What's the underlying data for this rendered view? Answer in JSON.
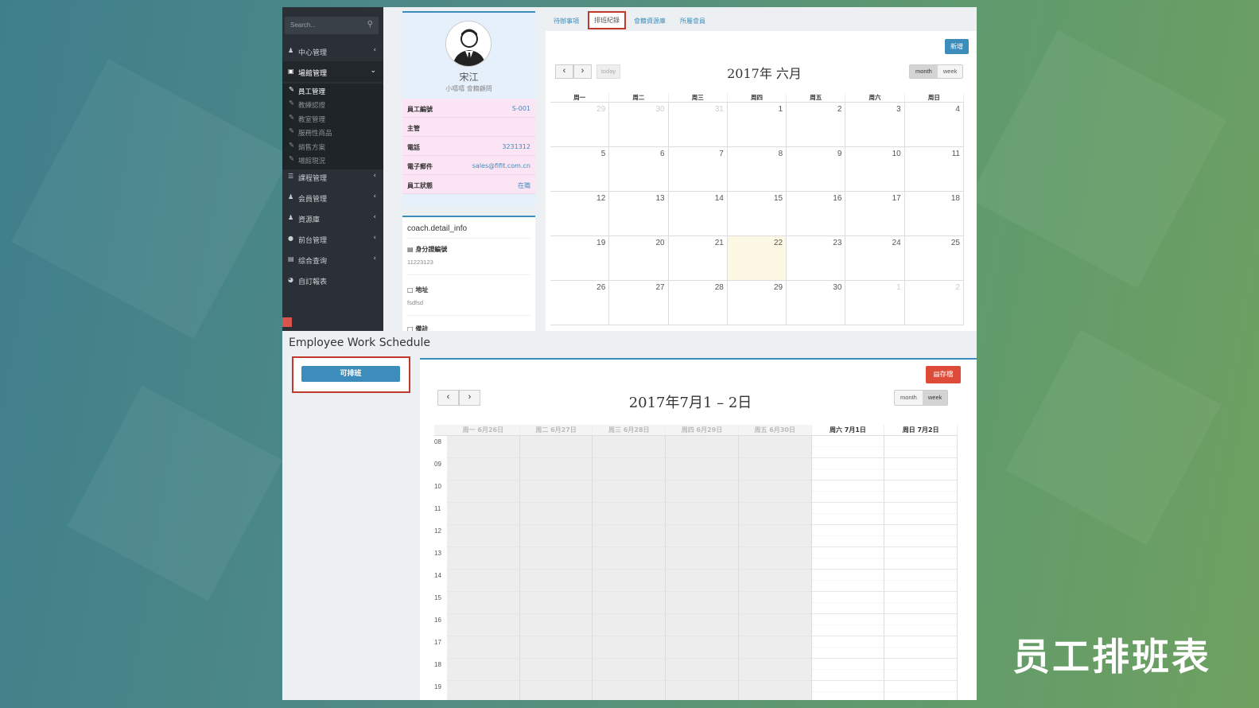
{
  "overlay_title": "员工排班表",
  "sidebar": {
    "search_placeholder": "Search...",
    "items": [
      {
        "label": "中心管理",
        "icon": "user-tie-icon"
      },
      {
        "label": "場館管理",
        "icon": "building-icon"
      },
      {
        "label": "課程管理",
        "icon": "book-icon"
      },
      {
        "label": "会員管理",
        "icon": "users-icon"
      },
      {
        "label": "資源庫",
        "icon": "user-icon"
      },
      {
        "label": "前台管理",
        "icon": "comments-icon"
      },
      {
        "label": "综合查询",
        "icon": "chart-icon"
      },
      {
        "label": "自訂報表",
        "icon": "pie-icon"
      }
    ],
    "sub_items": [
      "員工管理",
      "教練認證",
      "教室管理",
      "服務性商品",
      "銷售方案",
      "場館現況"
    ]
  },
  "profile": {
    "name": "宋江",
    "role": "小嘻嘻 會籍顧問",
    "rows": [
      {
        "key": "員工編號",
        "value": "S-001"
      },
      {
        "key": "主管",
        "value": ""
      },
      {
        "key": "電話",
        "value": "3231312"
      },
      {
        "key": "電子郵件",
        "value": "sales@fifit.com.cn"
      },
      {
        "key": "員工狀態",
        "value": "在職"
      }
    ]
  },
  "detail": {
    "header": "coach.detail_info",
    "id_label": "身分證編號",
    "id_value": "11223123",
    "addr_label": "地址",
    "addr_value": "fsdfsd",
    "next_label": "備註"
  },
  "tabs": [
    "待辦事項",
    "排班紀錄",
    "會籍資源庫",
    "所屬會員"
  ],
  "month_cal": {
    "new_label": "新增",
    "today_label": "today",
    "title": "2017年 六月",
    "view_month": "month",
    "view_week": "week",
    "weekdays": [
      "周一",
      "周二",
      "周三",
      "周四",
      "周五",
      "周六",
      "周日"
    ],
    "weeks": [
      [
        "29",
        "30",
        "31",
        "1",
        "2",
        "3",
        "4"
      ],
      [
        "5",
        "6",
        "7",
        "8",
        "9",
        "10",
        "11"
      ],
      [
        "12",
        "13",
        "14",
        "15",
        "16",
        "17",
        "18"
      ],
      [
        "19",
        "20",
        "21",
        "22",
        "23",
        "24",
        "25"
      ],
      [
        "26",
        "27",
        "28",
        "29",
        "30",
        "1",
        "2"
      ]
    ]
  },
  "schedule": {
    "title": "Employee Work Schedule",
    "available_label": "可排班",
    "save_label": "存檔",
    "week_title": "2017年7月1 – 2日",
    "view_month": "month",
    "view_week": "week",
    "days": [
      "周一 6月26日",
      "周二 6月27日",
      "周三 6月28日",
      "周四 6月29日",
      "周五 6月30日",
      "周六 7月1日",
      "周日 7月2日"
    ],
    "hours": [
      "08",
      "09",
      "10",
      "11",
      "12",
      "13",
      "14",
      "15",
      "16",
      "17",
      "18",
      "19"
    ]
  },
  "colors": {
    "accent": "#3c8dbc",
    "danger": "#dd4b39",
    "highlight": "#c0392b"
  }
}
